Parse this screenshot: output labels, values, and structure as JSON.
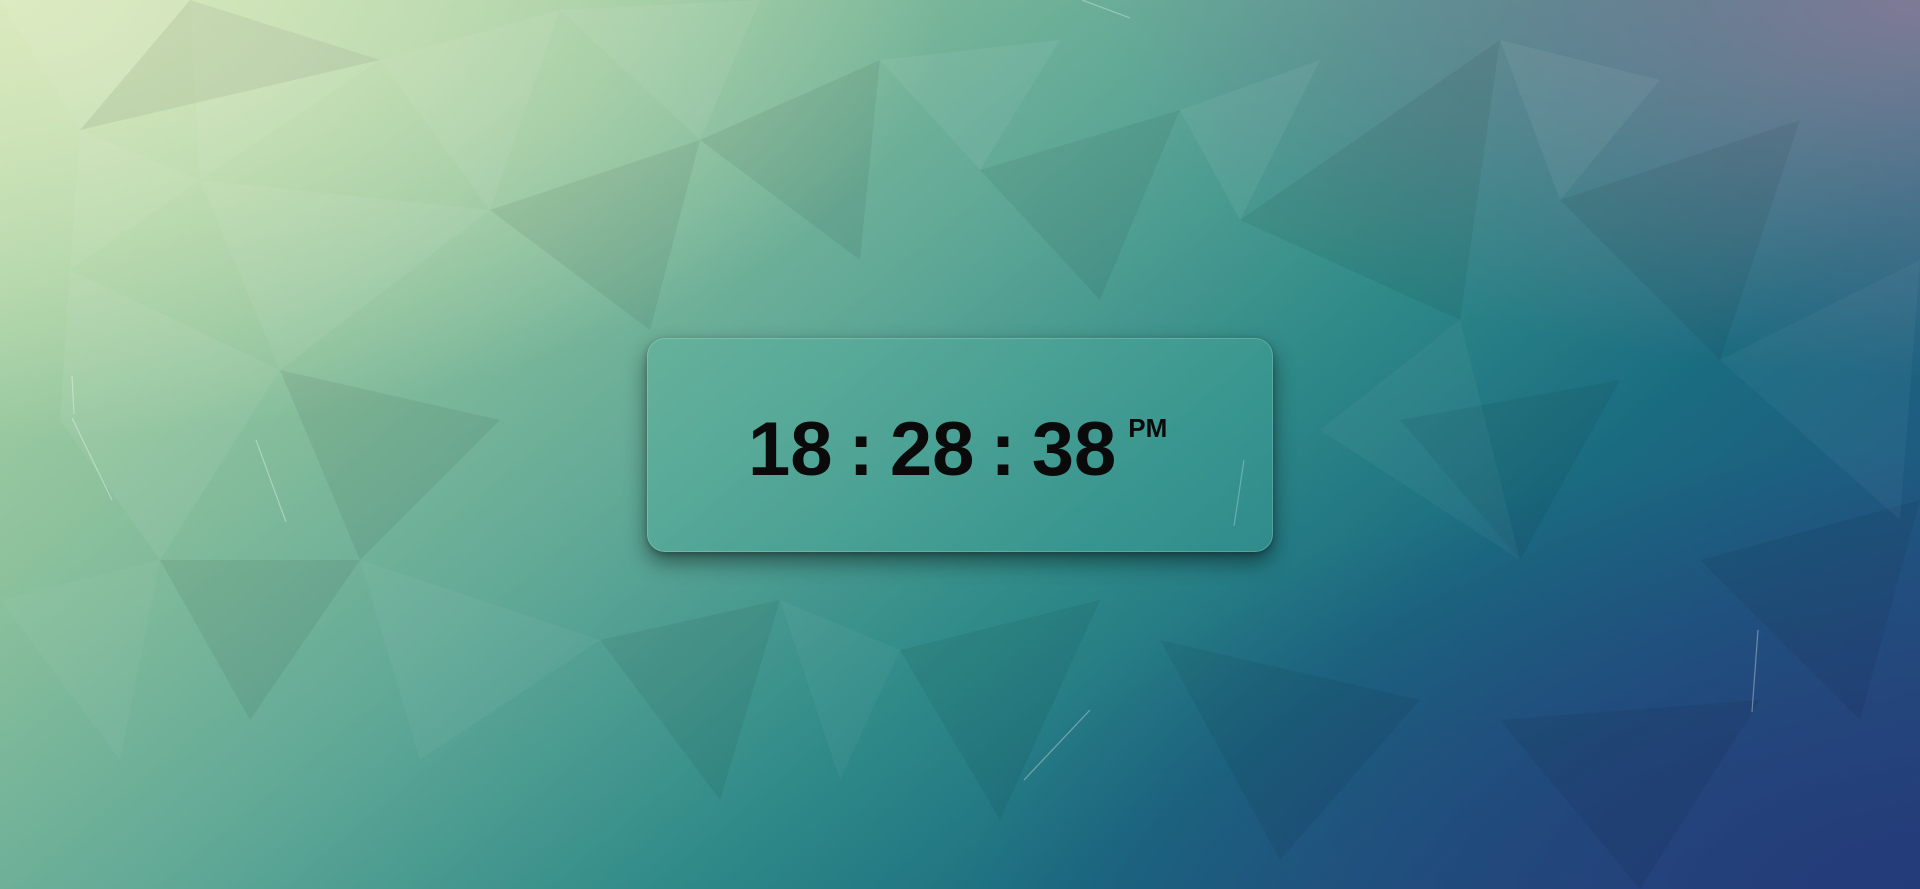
{
  "clock": {
    "hours": "18",
    "separator_1": ":",
    "minutes": "28",
    "separator_2": ":",
    "seconds": "38",
    "period": "PM"
  },
  "colors": {
    "background_top_left": "#dbe9bf",
    "background_mid": "#2f8a88",
    "background_bottom_right": "#243b79",
    "background_top_right": "#7f7a96",
    "clock_text": "#0a0a0a"
  }
}
